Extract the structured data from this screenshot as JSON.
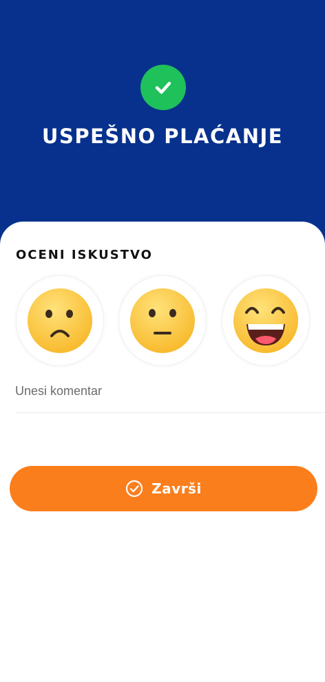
{
  "header": {
    "title": "USPEŠNO PLAĆANJE",
    "background_color": "#07318d",
    "icon": "check-circle-icon",
    "icon_color": "#1fc15a"
  },
  "rating": {
    "title": "OCENI ISKUSTVO",
    "options": [
      {
        "icon": "sad-face-icon"
      },
      {
        "icon": "neutral-face-icon"
      },
      {
        "icon": "happy-face-icon"
      }
    ]
  },
  "comment": {
    "placeholder": "Unesi komentar",
    "value": ""
  },
  "finish_button": {
    "label": "Završi",
    "icon": "check-circle-outline-icon",
    "color": "#fb7e1c"
  }
}
